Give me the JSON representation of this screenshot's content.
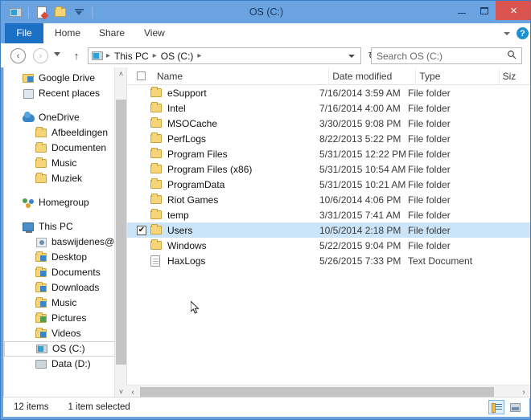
{
  "window": {
    "title": "OS (C:)",
    "accent_color": "#6ba3e0",
    "close_color": "#d9534f",
    "selection_color": "#cce4f7",
    "controls": {
      "minimize": "minimize",
      "maximize": "maximize",
      "close": "×"
    }
  },
  "quick_access": [
    {
      "name": "drive-icon",
      "label": "OS (C:)"
    },
    {
      "name": "properties-icon",
      "label": "Properties"
    },
    {
      "name": "new-folder-icon",
      "label": "New folder"
    },
    {
      "name": "customize-dropdown-icon",
      "label": "Customize Quick Access Toolbar"
    }
  ],
  "ribbon": {
    "tabs": [
      {
        "label": "File",
        "active": true
      },
      {
        "label": "Home",
        "active": false
      },
      {
        "label": "Share",
        "active": false
      },
      {
        "label": "View",
        "active": false
      }
    ],
    "minimize_ribbon": "chevron-down-icon",
    "help": "?"
  },
  "address_bar": {
    "back": "‹",
    "forward": "›",
    "up": "↑",
    "breadcrumb": [
      {
        "label": "This PC"
      },
      {
        "label": "OS (C:)"
      }
    ],
    "separator": "▸",
    "refresh": "↻"
  },
  "search": {
    "placeholder": "Search OS (C:)",
    "value": "Search OS (C:)",
    "icon": "search-icon"
  },
  "sidebar": {
    "groups": [
      {
        "items": [
          {
            "label": "Google Drive",
            "icon": "google-drive-icon",
            "level": 1,
            "selected": false
          },
          {
            "label": "Recent places",
            "icon": "recent-places-icon",
            "level": 1,
            "selected": false
          }
        ]
      },
      {
        "items": [
          {
            "label": "OneDrive",
            "icon": "onedrive-icon",
            "level": 0,
            "selected": false
          },
          {
            "label": "Afbeeldingen",
            "icon": "folder-icon",
            "level": 1,
            "selected": false
          },
          {
            "label": "Documenten",
            "icon": "folder-icon",
            "level": 1,
            "selected": false
          },
          {
            "label": "Music",
            "icon": "folder-icon",
            "level": 1,
            "selected": false
          },
          {
            "label": "Muziek",
            "icon": "folder-icon",
            "level": 1,
            "selected": false
          }
        ]
      },
      {
        "items": [
          {
            "label": "Homegroup",
            "icon": "homegroup-icon",
            "level": 0,
            "selected": false
          }
        ]
      },
      {
        "items": [
          {
            "label": "This PC",
            "icon": "this-pc-icon",
            "level": 0,
            "selected": false
          },
          {
            "label": "baswijdenes@outlook",
            "icon": "contact-icon",
            "level": 1,
            "selected": false
          },
          {
            "label": "Desktop",
            "icon": "desktop-folder-icon",
            "level": 1,
            "selected": false
          },
          {
            "label": "Documents",
            "icon": "documents-folder-icon",
            "level": 1,
            "selected": false
          },
          {
            "label": "Downloads",
            "icon": "downloads-folder-icon",
            "level": 1,
            "selected": false
          },
          {
            "label": "Music",
            "icon": "music-folder-icon",
            "level": 1,
            "selected": false
          },
          {
            "label": "Pictures",
            "icon": "pictures-folder-icon",
            "level": 1,
            "selected": false
          },
          {
            "label": "Videos",
            "icon": "videos-folder-icon",
            "level": 1,
            "selected": false
          },
          {
            "label": "OS (C:)",
            "icon": "windows-drive-icon",
            "level": 1,
            "selected": true
          },
          {
            "label": "Data (D:)",
            "icon": "drive-icon",
            "level": 1,
            "selected": false
          }
        ]
      }
    ],
    "scrollbar": {
      "up_arrow": "˄",
      "down_arrow": "˅"
    }
  },
  "file_list": {
    "columns": [
      {
        "label": "Name",
        "key": "name"
      },
      {
        "label": "Date modified",
        "key": "date"
      },
      {
        "label": "Type",
        "key": "type"
      },
      {
        "label": "Siz",
        "key": "size"
      }
    ],
    "select_all_checked": false,
    "check_mark": "✔",
    "rows": [
      {
        "name": "eSupport",
        "date": "7/16/2014 3:59 AM",
        "type": "File folder",
        "size": "",
        "icon": "folder-icon",
        "selected": false,
        "checked": false
      },
      {
        "name": "Intel",
        "date": "7/16/2014 4:00 AM",
        "type": "File folder",
        "size": "",
        "icon": "folder-icon",
        "selected": false,
        "checked": false
      },
      {
        "name": "MSOCache",
        "date": "3/30/2015 9:08 PM",
        "type": "File folder",
        "size": "",
        "icon": "folder-icon",
        "selected": false,
        "checked": false
      },
      {
        "name": "PerfLogs",
        "date": "8/22/2013 5:22 PM",
        "type": "File folder",
        "size": "",
        "icon": "folder-icon",
        "selected": false,
        "checked": false
      },
      {
        "name": "Program Files",
        "date": "5/31/2015 12:22 PM",
        "type": "File folder",
        "size": "",
        "icon": "folder-icon",
        "selected": false,
        "checked": false
      },
      {
        "name": "Program Files (x86)",
        "date": "5/31/2015 10:54 AM",
        "type": "File folder",
        "size": "",
        "icon": "folder-icon",
        "selected": false,
        "checked": false
      },
      {
        "name": "ProgramData",
        "date": "5/31/2015 10:21 AM",
        "type": "File folder",
        "size": "",
        "icon": "folder-icon",
        "selected": false,
        "checked": false
      },
      {
        "name": "Riot Games",
        "date": "10/6/2014 4:06 PM",
        "type": "File folder",
        "size": "",
        "icon": "folder-icon",
        "selected": false,
        "checked": false
      },
      {
        "name": "temp",
        "date": "3/31/2015 7:41 AM",
        "type": "File folder",
        "size": "",
        "icon": "folder-icon",
        "selected": false,
        "checked": false
      },
      {
        "name": "Users",
        "date": "10/5/2014 2:18 PM",
        "type": "File folder",
        "size": "",
        "icon": "folder-icon",
        "selected": true,
        "checked": true
      },
      {
        "name": "Windows",
        "date": "5/22/2015 9:04 PM",
        "type": "File folder",
        "size": "",
        "icon": "folder-icon",
        "selected": false,
        "checked": false
      },
      {
        "name": "HaxLogs",
        "date": "5/26/2015 7:33 PM",
        "type": "Text Document",
        "size": "",
        "icon": "text-document-icon",
        "selected": false,
        "checked": false
      }
    ],
    "h_scrollbar": {
      "left_arrow": "‹",
      "right_arrow": "›"
    }
  },
  "status_bar": {
    "item_count": "12 items",
    "selection": "1 item selected",
    "views": [
      {
        "name": "details-view-button",
        "active": true
      },
      {
        "name": "large-icons-view-button",
        "active": false
      }
    ]
  }
}
